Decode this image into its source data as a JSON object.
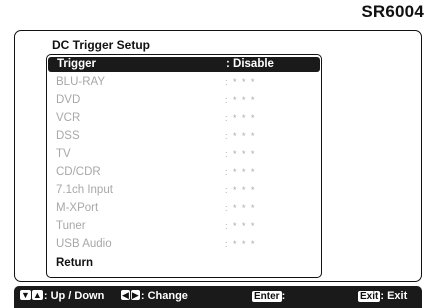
{
  "model": "SR6004",
  "screen": {
    "title": "DC Trigger Setup"
  },
  "menu": {
    "items": [
      {
        "label": "Trigger",
        "value": ": Disable"
      },
      {
        "label": "BLU-RAY",
        "value": ": * * *"
      },
      {
        "label": "DVD",
        "value": ": * * *"
      },
      {
        "label": "VCR",
        "value": ": * * *"
      },
      {
        "label": "DSS",
        "value": ": * * *"
      },
      {
        "label": "TV",
        "value": ": * * *"
      },
      {
        "label": "CD/CDR",
        "value": ": * * *"
      },
      {
        "label": "7.1ch Input",
        "value": ": * * *"
      },
      {
        "label": "M-XPort",
        "value": ": * * *"
      },
      {
        "label": "Tuner",
        "value": ": * * *"
      },
      {
        "label": "USB Audio",
        "value": ": * * *"
      },
      {
        "label": "Return",
        "value": ""
      }
    ]
  },
  "footer": {
    "down_key": "▼",
    "up_key": "▲",
    "updown_text": ": Up / Down",
    "left_key": "◀",
    "right_key": "▶",
    "change_text": ": Change",
    "enter_key": "Enter",
    "enter_text": ":",
    "exit_key": "Exit",
    "exit_text": ": Exit"
  }
}
